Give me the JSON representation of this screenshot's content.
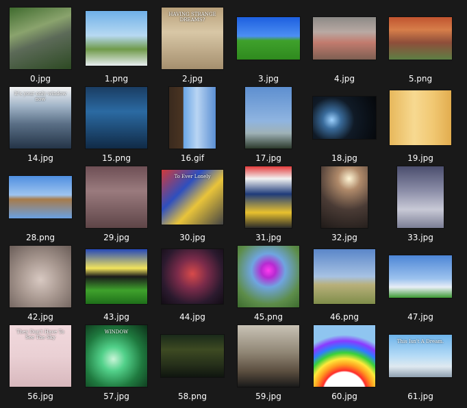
{
  "window": {
    "background": "#191919"
  },
  "files": [
    {
      "name": "0.jpg",
      "shape": "square",
      "bg": "linear-gradient(160deg,#3f6b2e 0%,#8aa36d 35%,#5c6a58 55%,#2d4a23 100%)"
    },
    {
      "name": "1.png",
      "shape": "landscape",
      "bg": "linear-gradient(180deg,#6fb0e8 0%,#b7d9f2 45%,#6f9a4a 70%,#e8eef2 100%)"
    },
    {
      "name": "2.jpg",
      "shape": "square",
      "bg": "linear-gradient(180deg,#b8a07a 0%,#d8c7a6 40%,#a58f6e 100%)",
      "text": "HAVING STRANGE DREAMS?"
    },
    {
      "name": "3.jpg",
      "shape": "wide",
      "bg": "linear-gradient(180deg,#1d5fe0 0%,#4c8ff2 45%,#3fa12c 55%,#2f8a1e 100%)"
    },
    {
      "name": "4.jpg",
      "shape": "wide",
      "bg": "linear-gradient(180deg,#8c8a86 0%,#b9a9a3 35%,#c27b6e 60%,#7e5f52 100%)"
    },
    {
      "name": "5.png",
      "shape": "wide",
      "bg": "linear-gradient(180deg,#c1542f 0%,#d67e4a 30%,#8f4e3a 60%,#5d7f44 100%)"
    },
    {
      "name": "14.jpg",
      "shape": "square",
      "bg": "linear-gradient(180deg,#f4f4f4 0%,#a3b6c9 30%,#5a6f86 60%,#243447 100%)",
      "text": "It's your only window now"
    },
    {
      "name": "15.png",
      "shape": "square",
      "bg": "linear-gradient(180deg,#1a3d63 0%,#2b6aa2 40%,#102a46 100%)"
    },
    {
      "name": "16.gif",
      "shape": "portrait",
      "bg": "linear-gradient(90deg,#3a2a1e 0%,#4a3422 30%,#6aa6e6 31%,#b9d5f3 60%,#5b8fd3 100%)"
    },
    {
      "name": "17.jpg",
      "shape": "portrait",
      "bg": "linear-gradient(180deg,#5d8fd0 0%,#8fb4e0 55%,#9fb2b6 75%,#2c3a2c 100%)"
    },
    {
      "name": "18.jpg",
      "shape": "wide",
      "bg": "radial-gradient(circle at 30% 55%,#9ed2ff 0%,#3a6c9c 18%,#101a26 45%,#05070a 100%)"
    },
    {
      "name": "19.jpg",
      "shape": "landscape",
      "bg": "linear-gradient(90deg,#e7b85c 0%,#f7d991 40%,#f1c873 70%,#e2ad4f 100%)"
    },
    {
      "name": "28.png",
      "shape": "wide",
      "bg": "linear-gradient(180deg,#4f8fe0 0%,#9ec4f0 45%,#a77b4a 55%,#6aa0e2 100%)"
    },
    {
      "name": "29.jpg",
      "shape": "square",
      "bg": "linear-gradient(180deg,#6e4f55 0%,#9a7b7e 40%,#5e4547 100%)"
    },
    {
      "name": "30.jpg",
      "shape": "landscape",
      "bg": "linear-gradient(135deg,#d23a3a 0%,#2e4fbf 35%,#e9c43a 60%,#444444 100%)",
      "text": "To Ever Lonely"
    },
    {
      "name": "31.jpg",
      "shape": "portrait",
      "bg": "linear-gradient(180deg,#e33c3c 0%,#f2f2f2 20%,#1f3b7a 45%,#e8c12e 75%,#2a2a2a 100%)"
    },
    {
      "name": "32.jpg",
      "shape": "portrait",
      "bg": "radial-gradient(circle at 60% 20%,#fff6d6 0%,#b08a6a 20%,#4a3b35 55%,#1f1a18 100%)"
    },
    {
      "name": "33.jpg",
      "shape": "portrait",
      "bg": "linear-gradient(180deg,#4b4e6e 0%,#8c8ea8 40%,#c8c9d6 70%,#7b7e95 100%)"
    },
    {
      "name": "42.jpg",
      "shape": "square",
      "bg": "radial-gradient(circle at 50% 55%,#d8c9c2 0%,#a89890 45%,#6a5d58 100%)"
    },
    {
      "name": "43.jpg",
      "shape": "landscape",
      "bg": "linear-gradient(180deg,#2548b8 0%,#f2e45c 35%,#1a1a1a 50%,#3fa12c 75%,#1f6f1a 100%)"
    },
    {
      "name": "44.jpg",
      "shape": "landscape",
      "bg": "radial-gradient(circle at 50% 45%,#d84a4a 0%,#7a2b4a 35%,#2b1a2e 70%,#120c14 100%)"
    },
    {
      "name": "45.png",
      "shape": "square",
      "bg": "radial-gradient(circle at 50% 40%,#ff3cf0 0%,#b72ad1 15%,#6fa5e0 35%,#5d8d4a 70%,#3d6b2e 100%)"
    },
    {
      "name": "46.png",
      "shape": "landscape",
      "bg": "linear-gradient(180deg,#5a86c9 0%,#a7c2e3 50%,#b8b07a 65%,#7f8d4a 100%)"
    },
    {
      "name": "47.jpg",
      "shape": "wide",
      "bg": "linear-gradient(180deg,#4d86d6 0%,#9cc2ee 55%,#e8eef6 75%,#3c9a34 100%)"
    },
    {
      "name": "56.jpg",
      "shape": "square",
      "bg": "linear-gradient(180deg,#f1d9dd 0%,#ead0d4 50%,#d8b8bd 100%)",
      "text": "They Don't Have To See The Sky"
    },
    {
      "name": "57.jpg",
      "shape": "square",
      "bg": "radial-gradient(circle at 45% 55%,#c9f5d8 0%,#52d18a 25%,#1f7a3f 60%,#0d2f18 100%)",
      "text": "WINDOW"
    },
    {
      "name": "58.png",
      "shape": "wide",
      "bg": "linear-gradient(180deg,#1a2a1a 0%,#3d4a22 35%,#26301a 70%,#0f150f 100%)"
    },
    {
      "name": "59.jpg",
      "shape": "square",
      "bg": "linear-gradient(180deg,#c9c3b6 0%,#8f8574 45%,#5b4e3f 75%,#1a1a1a 100%)"
    },
    {
      "name": "60.jpg",
      "shape": "square",
      "bg": "radial-gradient(circle at 50% 110%,#ffffff 0%,#ffffff 28%,#ff2a2a 30%,#ff9a1f 38%,#ffe93a 46%,#3ad13a 54%,#2f7cff 62%,#8a3aff 70%,#8fc5f0 78%,#8fc5f0 100%)"
    },
    {
      "name": "61.jpg",
      "shape": "wide",
      "bg": "linear-gradient(180deg,#6db3ea 0%,#b5dbf6 50%,#dfe9f0 75%,#8fa0b0 100%)",
      "text": "This Isn't A Dream."
    }
  ]
}
